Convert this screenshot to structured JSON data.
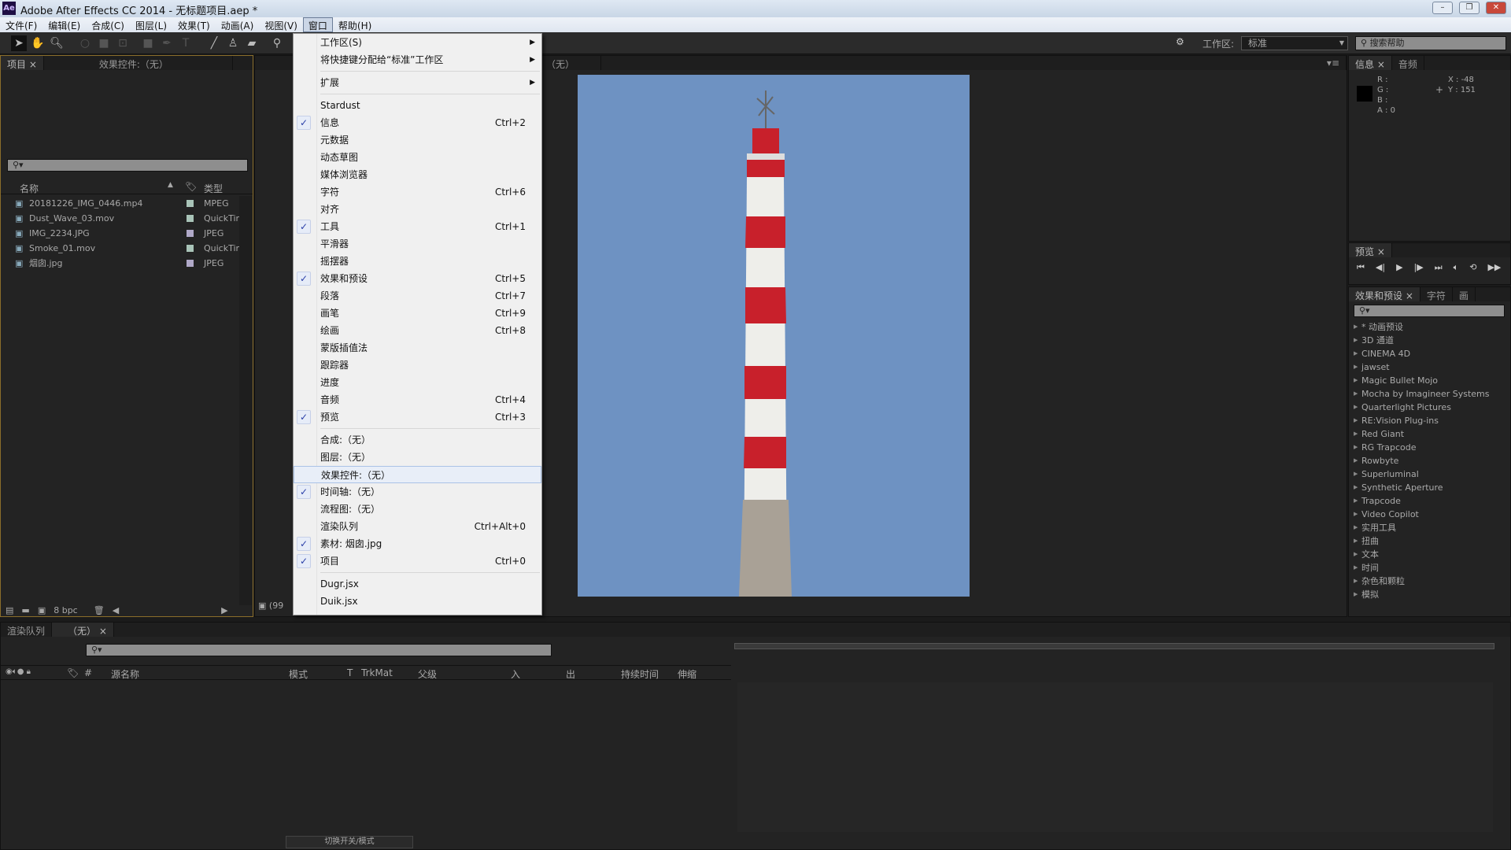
{
  "window": {
    "title": "Adobe After Effects CC 2014 - 无标题项目.aep *",
    "logo": "Ae"
  },
  "menubar": [
    "文件(F)",
    "编辑(E)",
    "合成(C)",
    "图层(L)",
    "效果(T)",
    "动画(A)",
    "视图(V)",
    "窗口",
    "帮助(H)"
  ],
  "toolbar": {
    "workspace_label": "工作区:",
    "workspace_value": "标准",
    "search_help": "搜索帮助"
  },
  "project": {
    "tabs": [
      "项目",
      "效果控件:（无）"
    ],
    "col_name": "名称",
    "col_type": "类型",
    "items": [
      {
        "name": "20181226_IMG_0446.mp4",
        "type": "MPEG",
        "color": "#a9c4b8"
      },
      {
        "name": "Dust_Wave_03.mov",
        "type": "QuickTim",
        "color": "#a9c4b8"
      },
      {
        "name": "IMG_2234.JPG",
        "type": "JPEG",
        "color": "#b0a9c8"
      },
      {
        "name": "Smoke_01.mov",
        "type": "QuickTim",
        "color": "#a9c4b8"
      },
      {
        "name": "烟囱.jpg",
        "type": "JPEG",
        "color": "#b0a9c8"
      }
    ],
    "bpc": "8 bpc"
  },
  "viewer": {
    "tab": "（无）",
    "zoom": "(99"
  },
  "window_menu": [
    {
      "label": "工作区(S)",
      "submenu": true
    },
    {
      "label": "将快捷键分配给“标准”工作区",
      "submenu": true
    },
    {
      "sep": true
    },
    {
      "label": "扩展",
      "submenu": true
    },
    {
      "sep": true
    },
    {
      "label": "Stardust"
    },
    {
      "label": "信息",
      "shortcut": "Ctrl+2",
      "checked": true
    },
    {
      "label": "元数据"
    },
    {
      "label": "动态草图"
    },
    {
      "label": "媒体浏览器"
    },
    {
      "label": "字符",
      "shortcut": "Ctrl+6"
    },
    {
      "label": "对齐"
    },
    {
      "label": "工具",
      "shortcut": "Ctrl+1",
      "checked": true
    },
    {
      "label": "平滑器"
    },
    {
      "label": "摇摆器"
    },
    {
      "label": "效果和预设",
      "shortcut": "Ctrl+5",
      "checked": true
    },
    {
      "label": "段落",
      "shortcut": "Ctrl+7"
    },
    {
      "label": "画笔",
      "shortcut": "Ctrl+9"
    },
    {
      "label": "绘画",
      "shortcut": "Ctrl+8"
    },
    {
      "label": "蒙版插值法"
    },
    {
      "label": "跟踪器"
    },
    {
      "label": "进度"
    },
    {
      "label": "音频",
      "shortcut": "Ctrl+4"
    },
    {
      "label": "预览",
      "shortcut": "Ctrl+3",
      "checked": true
    },
    {
      "sep": true
    },
    {
      "label": "合成:（无）"
    },
    {
      "label": "图层:（无）"
    },
    {
      "label": "效果控件:（无）",
      "highlighted": true
    },
    {
      "label": "时间轴:（无）",
      "checked": true
    },
    {
      "label": "流程图:（无）"
    },
    {
      "label": "渲染队列",
      "shortcut": "Ctrl+Alt+0"
    },
    {
      "label": "素材: 烟囱.jpg",
      "checked": true
    },
    {
      "label": "项目",
      "shortcut": "Ctrl+0",
      "checked": true
    },
    {
      "sep": true
    },
    {
      "label": "Dugr.jsx"
    },
    {
      "label": "Duik.jsx"
    }
  ],
  "info": {
    "tabs": [
      "信息",
      "音频"
    ],
    "r": "R :",
    "g": "G :",
    "b": "B :",
    "a": "A : 0",
    "x": "X : -48",
    "y": "Y : 151"
  },
  "preview": {
    "tab": "预览"
  },
  "effects": {
    "tabs": [
      "效果和预设",
      "字符",
      "画"
    ],
    "items": [
      "* 动画预设",
      "3D 通道",
      "CINEMA 4D",
      "jawset",
      "Magic Bullet Mojo",
      "Mocha by Imagineer Systems",
      "Quarterlight Pictures",
      "RE:Vision Plug-ins",
      "Red Giant",
      "RG Trapcode",
      "Rowbyte",
      "Superluminal",
      "Synthetic Aperture",
      "Trapcode",
      "Video Copilot",
      "实用工具",
      "扭曲",
      "文本",
      "时间",
      "杂色和颗粒",
      "模拟"
    ]
  },
  "timeline": {
    "tabs": [
      "渲染队列",
      "（无）"
    ],
    "columns": [
      "#",
      "源名称",
      "模式",
      "T",
      "TrkMat",
      "父级",
      "入",
      "出",
      "持续时间",
      "伸缩"
    ],
    "toggle": "切换开关/模式"
  }
}
